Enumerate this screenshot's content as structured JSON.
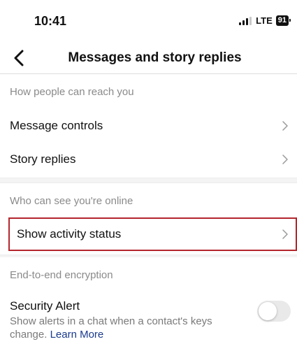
{
  "status_bar": {
    "time": "10:41",
    "network": "LTE",
    "battery": "91"
  },
  "header": {
    "title": "Messages and story replies",
    "back_icon": "chevron-left-icon"
  },
  "sections": [
    {
      "header": "How people can reach you",
      "items": [
        {
          "label": "Message controls",
          "icon": "chevron-right-icon"
        },
        {
          "label": "Story replies",
          "icon": "chevron-right-icon"
        }
      ]
    },
    {
      "header": "Who can see you're online",
      "items": [
        {
          "label": "Show activity status",
          "icon": "chevron-right-icon",
          "highlighted": true
        }
      ]
    },
    {
      "header": "End-to-end encryption",
      "items": [
        {
          "label": "Security Alert",
          "description": "Show alerts in a chat when a contact's keys change.",
          "link": "Learn More",
          "toggle_on": false
        }
      ]
    }
  ],
  "colors": {
    "highlight_border": "#b3262d",
    "link": "#1a3a8f",
    "section_header": "#8a8a8a",
    "toggle_off": "#e9e9ea"
  }
}
